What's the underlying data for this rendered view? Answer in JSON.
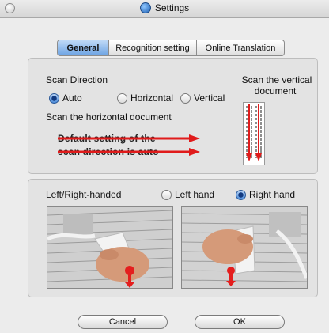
{
  "window": {
    "title": "Settings"
  },
  "tabs": [
    "General",
    "Recognition setting",
    "Online Translation"
  ],
  "scan": {
    "heading": "Scan Direction",
    "options": [
      "Auto",
      "Horizontal",
      "Vertical"
    ],
    "selected": "Auto",
    "horizontal_caption": "Scan the horizontal document",
    "vertical_caption_line1": "Scan the vertical",
    "vertical_caption_line2": "document",
    "demo_line1": "Default setting of the",
    "demo_line2": "scan direction is auto"
  },
  "hand": {
    "heading": "Left/Right-handed",
    "options": [
      "Left hand",
      "Right hand"
    ],
    "selected": "Right hand"
  },
  "buttons": {
    "cancel": "Cancel",
    "ok": "OK"
  }
}
